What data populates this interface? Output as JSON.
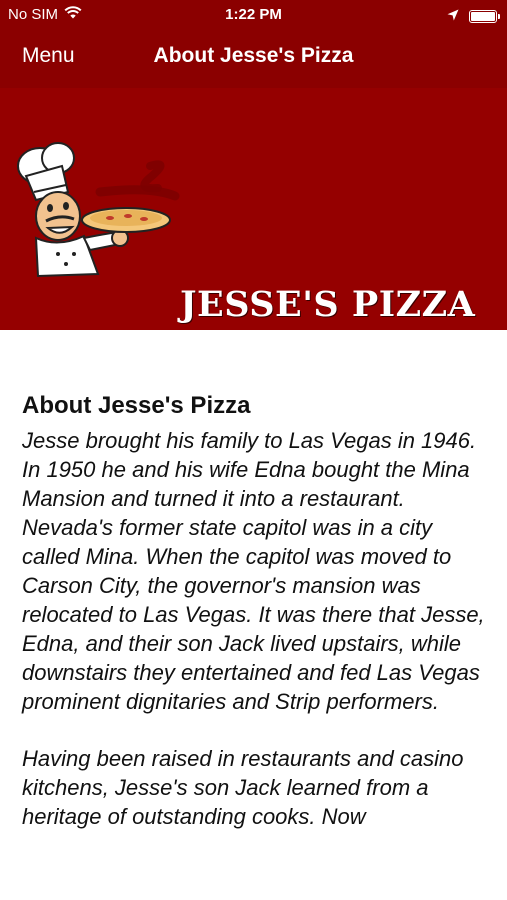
{
  "status_bar": {
    "carrier": "No SIM",
    "time": "1:22 PM"
  },
  "nav": {
    "menu_label": "Menu",
    "title": "About Jesse's Pizza"
  },
  "banner": {
    "logo_text": "JESSE'S PIZZA",
    "background_color": "#950000"
  },
  "about": {
    "heading": "About Jesse's Pizza",
    "paragraphs": [
      "Jesse brought his family to Las Vegas in 1946. In 1950 he and his wife Edna bought the Mina Mansion and turned it into a restaurant. Nevada's former state capitol was in a city called Mina. When the capitol was moved to Carson City, the governor's mansion was relocated to Las Vegas. It was there that Jesse, Edna, and their son Jack lived upstairs, while downstairs they entertained and fed Las Vegas prominent dignitaries and Strip performers.",
      "Having been raised in restaurants and casino kitchens, Jesse's son Jack learned from a heritage of outstanding cooks. Now"
    ]
  },
  "colors": {
    "brand": "#8b0000",
    "text": "#111111"
  },
  "icons": [
    "wifi-icon",
    "location-arrow-icon",
    "battery-icon",
    "chef-mascot-icon"
  ]
}
